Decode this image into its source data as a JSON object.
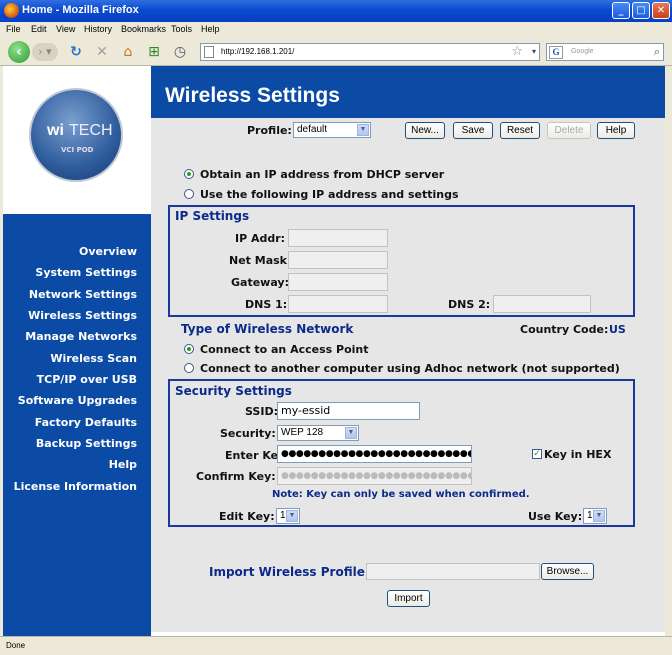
{
  "window": {
    "title": "Home - Mozilla Firefox"
  },
  "menu": [
    "File",
    "Edit",
    "View",
    "History",
    "Bookmarks",
    "Tools",
    "Help"
  ],
  "address": {
    "url": "http://192.168.1.201/"
  },
  "search": {
    "placeholder": "Google"
  },
  "status": {
    "text": "Done"
  },
  "logo": {
    "brand_wi": "wi",
    "brand_tech": "TECH",
    "product": "VCI POD"
  },
  "page": {
    "heading": "Wireless Settings"
  },
  "sidebar": {
    "items": [
      {
        "label": "Overview"
      },
      {
        "label": "System Settings"
      },
      {
        "label": "Network Settings"
      },
      {
        "label": "Wireless Settings"
      },
      {
        "label": "Manage Networks"
      },
      {
        "label": "Wireless Scan"
      },
      {
        "label": "TCP/IP over USB"
      },
      {
        "label": "Software Upgrades"
      },
      {
        "label": "Factory Defaults"
      },
      {
        "label": "Backup Settings"
      },
      {
        "label": "Help"
      },
      {
        "label": "License Information"
      }
    ]
  },
  "profile": {
    "label": "Profile:",
    "value": "default",
    "buttons": {
      "new": "New...",
      "save": "Save",
      "reset": "Reset",
      "delete": "Delete",
      "help": "Help"
    }
  },
  "ip_mode": {
    "dhcp_label": "Obtain an IP address from DHCP server",
    "static_label": "Use the following IP address and settings",
    "selected": "dhcp"
  },
  "ip_settings": {
    "title": "IP Settings",
    "ip_label": "IP Addr:",
    "mask_label": "Net Mask:",
    "gateway_label": "Gateway:",
    "dns1_label": "DNS 1:",
    "dns2_label": "DNS 2:",
    "ip_value": "",
    "mask_value": "",
    "gateway_value": "",
    "dns1_value": "",
    "dns2_value": ""
  },
  "network_type": {
    "title": "Type of Wireless Network",
    "country_label": "Country Code:",
    "country_value": "US",
    "ap_label": "Connect to an Access Point",
    "adhoc_label": "Connect to another computer using Adhoc network (not supported)",
    "selected": "ap"
  },
  "security": {
    "title": "Security Settings",
    "ssid_label": "SSID:",
    "ssid_value": "my-essid",
    "security_label": "Security:",
    "security_value": "WEP 128",
    "enter_key_label": "Enter Key:",
    "enter_key_value": "●●●●●●●●●●●●●●●●●●●●●●●●●●",
    "confirm_key_label": "Confirm Key:",
    "confirm_key_value": "●●●●●●●●●●●●●●●●●●●●●●●●●●",
    "hex_label": "Key in HEX",
    "hex_checked": true,
    "note": "Note: Key can only be saved when confirmed.",
    "edit_key_label": "Edit Key:",
    "edit_key_value": "1",
    "use_key_label": "Use Key:",
    "use_key_value": "1"
  },
  "import": {
    "title": "Import Wireless Profile",
    "browse_label": "Browse...",
    "import_label": "Import",
    "file_value": ""
  },
  "colors": {
    "brand_blue": "#0b4ba6",
    "section_blue": "#0b2a8a",
    "panel_gray": "#e6e6e6"
  }
}
